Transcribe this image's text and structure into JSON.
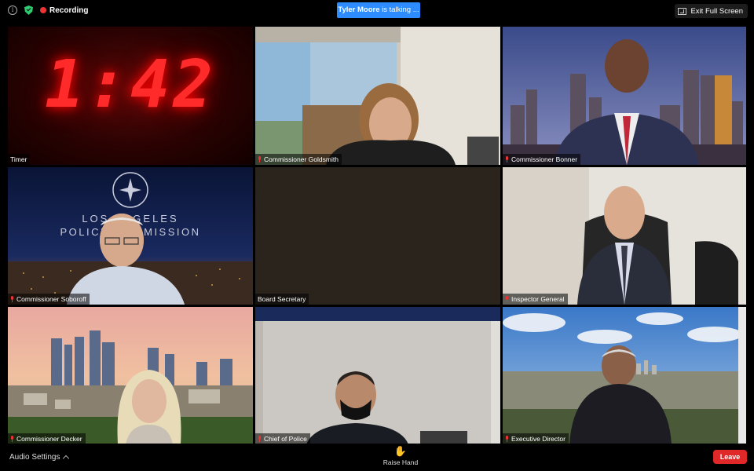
{
  "topbar": {
    "recording_label": "Recording",
    "talking_name": "Tyler Moore",
    "talking_suffix": " is talking ...",
    "exit_fullscreen_label": "Exit Full Screen"
  },
  "timer": {
    "display": "1:42"
  },
  "participants": [
    {
      "name": "Timer",
      "muted": false
    },
    {
      "name": "Commissioner Goldsmith",
      "muted": true
    },
    {
      "name": "Commissioner Bonner",
      "muted": true
    },
    {
      "name": "Commissioner Soboroff",
      "muted": true
    },
    {
      "name": "Board Secretary",
      "muted": false
    },
    {
      "name": "Inspector General",
      "muted": true
    },
    {
      "name": "Commissioner Decker",
      "muted": true
    },
    {
      "name": "Chief of Police",
      "muted": true
    },
    {
      "name": "Executive Director",
      "muted": true
    }
  ],
  "background_logo": {
    "line1": "LOS ANGELES",
    "line2": "POLICE COMMISSION"
  },
  "bottombar": {
    "audio_settings_label": "Audio Settings",
    "raise_hand_label": "Raise Hand",
    "leave_label": "Leave"
  },
  "colors": {
    "accent": "#2d8cff",
    "leave": "#e02828",
    "recording": "#ee3333",
    "secure": "#2ecc71"
  }
}
